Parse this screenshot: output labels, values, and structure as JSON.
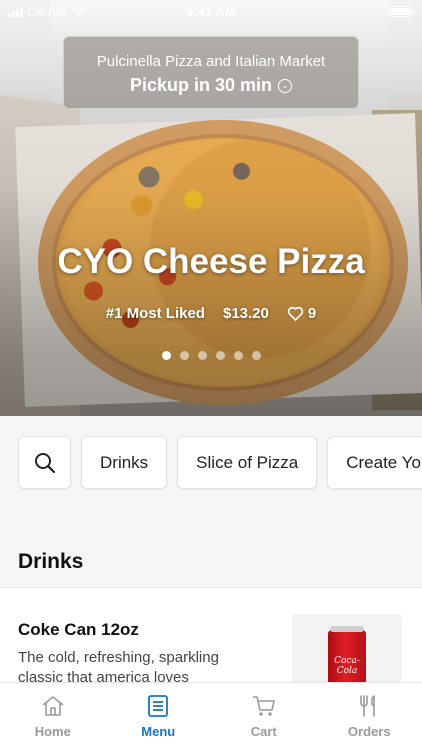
{
  "status_bar": {
    "carrier": "Carrier",
    "time": "9:41 AM"
  },
  "store": {
    "name": "Pulcinella Pizza and Italian Market",
    "pickup": "Pickup in 30 min"
  },
  "hero": {
    "title": "CYO Cheese Pizza",
    "rank": "#1 Most Liked",
    "price": "$13.20",
    "likes": "9",
    "slides_total": 6,
    "slide_active": 1
  },
  "categories": [
    {
      "label": "Drinks"
    },
    {
      "label": "Slice of Pizza"
    },
    {
      "label": "Create Your Own"
    }
  ],
  "section": {
    "title": "Drinks"
  },
  "item": {
    "name": "Coke Can 12oz",
    "description": "The cold, refreshing, sparkling classic that america loves",
    "image_brand": "Coca-Cola"
  },
  "tabs": [
    {
      "label": "Home",
      "icon": "home-icon",
      "active": false
    },
    {
      "label": "Menu",
      "icon": "menu-icon",
      "active": true
    },
    {
      "label": "Cart",
      "icon": "cart-icon",
      "active": false
    },
    {
      "label": "Orders",
      "icon": "orders-icon",
      "active": false
    }
  ],
  "colors": {
    "accent": "#1675c4",
    "inactive_tab": "#9a9a9a"
  }
}
